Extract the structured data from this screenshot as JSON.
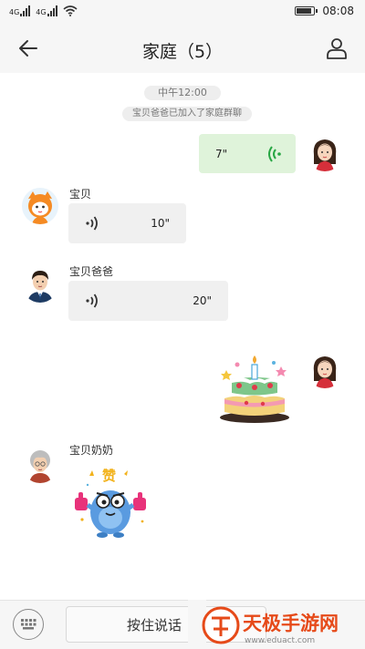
{
  "status_bar": {
    "time": "08:08",
    "net1": "4G",
    "net2": "4G"
  },
  "header": {
    "title": "家庭（5）"
  },
  "chat": {
    "time_label": "中午12:00",
    "system_notice": "宝贝爸爸已加入了家庭群聊",
    "messages": [
      {
        "side": "right",
        "type": "voice",
        "duration": "7\""
      },
      {
        "side": "left",
        "sender": "宝贝",
        "type": "voice",
        "duration": "10\""
      },
      {
        "side": "left",
        "sender": "宝贝爸爸",
        "type": "voice",
        "duration": "20\""
      },
      {
        "side": "right",
        "type": "sticker",
        "sticker": "birthday-cake"
      },
      {
        "side": "left",
        "sender": "宝贝奶奶",
        "type": "sticker",
        "sticker": "like-monster",
        "sticker_text": "赞"
      }
    ]
  },
  "footer": {
    "talk_label": "按住说话"
  },
  "watermark": {
    "brand": "天极手游网",
    "url": "www.eduact.com"
  },
  "colors": {
    "accent_green": "#dff3da",
    "voice_icon_green": "#27a643"
  }
}
